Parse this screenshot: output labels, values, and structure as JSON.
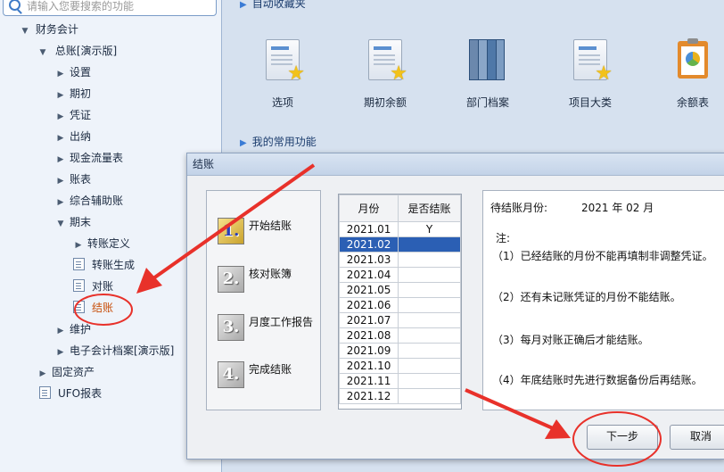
{
  "search": {
    "placeholder": "请输入您要搜索的功能"
  },
  "tree": {
    "root": "财务会计",
    "gl": "总账[演示版]",
    "items": [
      "设置",
      "期初",
      "凭证",
      "出纳",
      "现金流量表",
      "账表",
      "综合辅助账",
      "期末"
    ],
    "period_end_children": [
      "转账定义",
      "转账生成",
      "对账",
      "结账"
    ],
    "maintain": "维护",
    "e_archive": "电子会计档案[演示版]",
    "fixed_assets": "固定资产",
    "ufo": "UFO报表"
  },
  "main": {
    "auto_fav_title": "自动收藏夹",
    "common_title": "我的常用功能",
    "apps": [
      "选项",
      "期初余额",
      "部门档案",
      "项目大类",
      "余额表"
    ]
  },
  "dialog": {
    "title": "结账",
    "steps": [
      {
        "num": "1.",
        "label": "开始结账"
      },
      {
        "num": "2.",
        "label": "核对账簿"
      },
      {
        "num": "3.",
        "label": "月度工作报告"
      },
      {
        "num": "4.",
        "label": "完成结账"
      }
    ],
    "table": {
      "headers": [
        "月份",
        "是否结账"
      ],
      "rows": [
        [
          "2021.01",
          "Y"
        ],
        [
          "2021.02",
          ""
        ],
        [
          "2021.03",
          ""
        ],
        [
          "2021.04",
          ""
        ],
        [
          "2021.05",
          ""
        ],
        [
          "2021.06",
          ""
        ],
        [
          "2021.07",
          ""
        ],
        [
          "2021.08",
          ""
        ],
        [
          "2021.09",
          ""
        ],
        [
          "2021.10",
          ""
        ],
        [
          "2021.11",
          ""
        ],
        [
          "2021.12",
          ""
        ]
      ],
      "selected_row": 1
    },
    "info": {
      "pending_label": "待结账月份:",
      "pending_value": "2021 年 02 月",
      "note_title": "注:",
      "notes": [
        "（1）已经结账的月份不能再填制非调整凭证。",
        "（2）还有未记账凭证的月份不能结账。",
        "（3）每月对账正确后才能结账。",
        "（4）年底结账时先进行数据备份后再结账。"
      ]
    },
    "next_label": "下一步",
    "cancel_label": "取消"
  },
  "colors": {
    "accent": "#2b5fb4",
    "annotation": "#e8312a",
    "link": "#1c3d6e"
  }
}
